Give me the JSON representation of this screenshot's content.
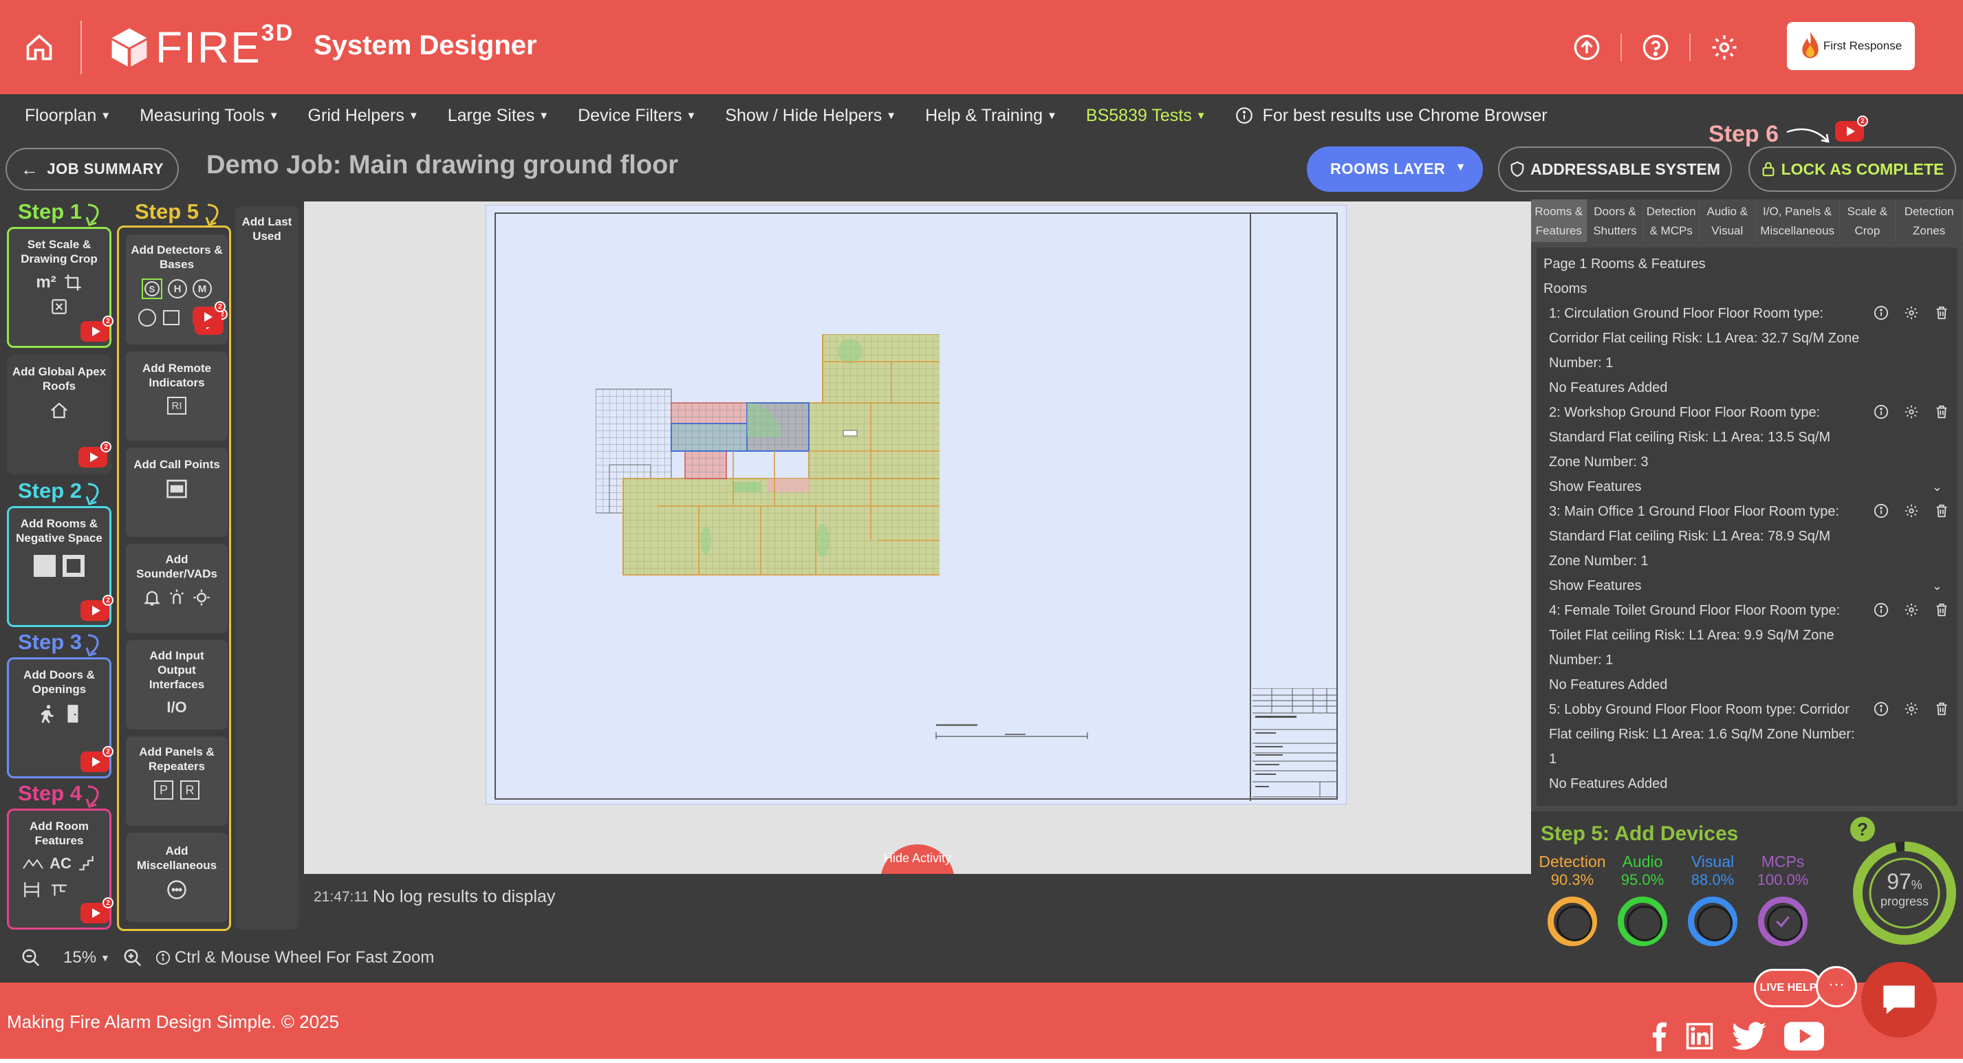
{
  "header": {
    "logo_text": "FIRE",
    "logo_sup": "3D",
    "app_title": "System Designer",
    "brand_text": "First Response"
  },
  "menu": {
    "items": [
      "Floorplan",
      "Measuring Tools",
      "Grid Helpers",
      "Large Sites",
      "Device Filters",
      "Show / Hide Helpers",
      "Help & Training",
      "BS5839 Tests"
    ],
    "info": "For best results use Chrome Browser"
  },
  "jobbar": {
    "job_summary": "JOB SUMMARY",
    "job_title": "Demo Job: Main drawing ground floor",
    "rooms_layer": "ROOMS LAYER",
    "addressable": "ADDRESSABLE SYSTEM",
    "lock": "LOCK AS COMPLETE",
    "step6": "Step 6"
  },
  "steps": {
    "step1": "Step 1",
    "step1_tool": "Set Scale & Drawing Crop",
    "global_apex": "Add Global Apex Roofs",
    "step2": "Step 2",
    "step2_tool": "Add Rooms & Negative Space",
    "step3": "Step 3",
    "step3_tool": "Add Doors & Openings",
    "step4": "Step 4",
    "step4_tool": "Add Room Features",
    "step4_ac": "AC",
    "step5": "Step 5",
    "s5_detectors": "Add Detectors & Bases",
    "s5_remote": "Add Remote Indicators",
    "s5_remote_icon": "RI",
    "s5_callpoints": "Add Call Points",
    "s5_sounders": "Add Sounder/VADs",
    "s5_io": "Add Input Output Interfaces",
    "s5_io_icon": "I/O",
    "s5_panels": "Add Panels & Repeaters",
    "s5_panel_p": "P",
    "s5_panel_r": "R",
    "s5_misc": "Add Miscellaneous",
    "last_used": "Add Last Used",
    "det_s": "S",
    "det_h": "H",
    "det_m": "M",
    "yt_badge": "2"
  },
  "canvas": {
    "hide_activity": "Hide Activity"
  },
  "log": {
    "time": "21:47:11",
    "message": "No log results to display"
  },
  "zoom": {
    "level": "15%",
    "hint": "Ctrl & Mouse Wheel For Fast Zoom"
  },
  "right_panel": {
    "tabs": [
      [
        "Rooms &",
        "Features"
      ],
      [
        "Doors &",
        "Shutters"
      ],
      [
        "Detection",
        "& MCPs"
      ],
      [
        "Audio &",
        "Visual"
      ],
      [
        "I/O, Panels &",
        "Miscellaneous"
      ],
      [
        "Scale &",
        "Crop"
      ],
      [
        "Detection",
        "Zones"
      ]
    ],
    "page_heading": "Page 1 Rooms & Features",
    "rooms_heading": "Rooms",
    "rooms": [
      {
        "text": "1: Circulation Ground Floor Floor Room type: Corridor Flat ceiling Risk: L1 Area: 32.7 Sq/M Zone Number: 1",
        "feature": "No Features Added"
      },
      {
        "text": "2: Workshop Ground Floor Floor Room type: Standard Flat ceiling Risk: L1 Area: 13.5 Sq/M Zone Number: 3",
        "feature": "Show Features"
      },
      {
        "text": "3: Main Office 1 Ground Floor Floor Room type: Standard Flat ceiling Risk: L1 Area: 78.9 Sq/M Zone Number: 1",
        "feature": "Show Features"
      },
      {
        "text": "4: Female Toilet Ground Floor Floor Room type: Toilet Flat ceiling Risk: L1 Area: 9.9 Sq/M Zone Number: 1",
        "feature": "No Features Added"
      },
      {
        "text": "5: Lobby Ground Floor Floor Room type: Corridor Flat ceiling Risk: L1 Area: 1.6 Sq/M Zone Number: 1",
        "feature": "No Features Added"
      }
    ]
  },
  "devices": {
    "title": "Step 5: Add Devices",
    "stats": [
      {
        "label": "Detection",
        "pct": "90.3%",
        "color": "#f2a93b"
      },
      {
        "label": "Audio",
        "pct": "95.0%",
        "color": "#3ad13a"
      },
      {
        "label": "Visual",
        "pct": "88.0%",
        "color": "#3b8cf0"
      },
      {
        "label": "MCPs",
        "pct": "100.0%",
        "color": "#a45ec2"
      }
    ],
    "progress_value": "97",
    "progress_unit": "%",
    "progress_word": "progress",
    "progress_fraction": 0.97,
    "help_q": "?"
  },
  "footer": {
    "text": "Making Fire Alarm Design Simple. © 2025",
    "live_help": "LIVE HELP",
    "dots": "···"
  },
  "colors": {
    "accent": "#e9564f",
    "step1": "#8fe64a",
    "step2": "#4ad8e6",
    "step3": "#6a8cf5",
    "step4": "#e6428c",
    "step5": "#e7c53a",
    "lock": "#c6f05a"
  }
}
